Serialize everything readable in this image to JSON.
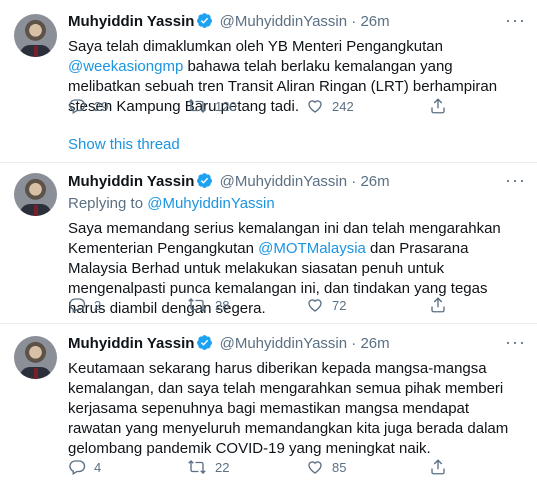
{
  "tweets": [
    {
      "name": "Muhyiddin Yassin",
      "handle": "@MuhyiddinYassin",
      "dot": "·",
      "time": "26m",
      "text_parts": [
        "Saya telah dimaklumkan oleh YB Menteri Pengangkutan ",
        "@weekasiongmp",
        " bahawa telah berlaku kemalangan yang melibatkan sebuah tren Transit Aliran Ringan (LRT) berhampiran stesen Kampung Baru petang tadi."
      ],
      "replies": "29",
      "retweets": "120",
      "likes": "242",
      "show_thread": "Show this thread"
    },
    {
      "name": "Muhyiddin Yassin",
      "handle": "@MuhyiddinYassin",
      "dot": "·",
      "time": "26m",
      "reply_prefix": "Replying to ",
      "reply_handle": "@MuhyiddinYassin",
      "text_parts": [
        "Saya memandang serius kemalangan ini dan telah mengarahkan Kementerian Pengangkutan ",
        "@MOTMalaysia",
        " dan Prasarana Malaysia Berhad untuk melakukan siasatan penuh untuk mengenalpasti punca kemalangan ini, dan tindakan yang tegas harus diambil dengan segera."
      ],
      "replies": "2",
      "retweets": "28",
      "likes": "72"
    },
    {
      "name": "Muhyiddin Yassin",
      "handle": "@MuhyiddinYassin",
      "dot": "·",
      "time": "26m",
      "text": "Keutamaan sekarang harus diberikan kepada mangsa-mangsa  kemalangan, dan saya telah mengarahkan semua pihak memberi kerjasama sepenuhnya bagi memastikan mangsa mendapat rawatan yang menyeluruh memandangkan kita juga berada dalam gelombang pandemik COVID-19 yang meningkat naik.",
      "replies": "4",
      "retweets": "22",
      "likes": "85"
    }
  ],
  "colors": {
    "link": "#1b95e0",
    "muted": "#5b7083",
    "verified": "#1da1f2",
    "text": "#0f1419",
    "divider": "#e6ecf0"
  },
  "icons": {
    "reply": "reply-icon",
    "retweet": "retweet-icon",
    "like": "heart-icon",
    "share": "share-icon",
    "more": "more-icon",
    "verified": "verified-badge-icon"
  }
}
